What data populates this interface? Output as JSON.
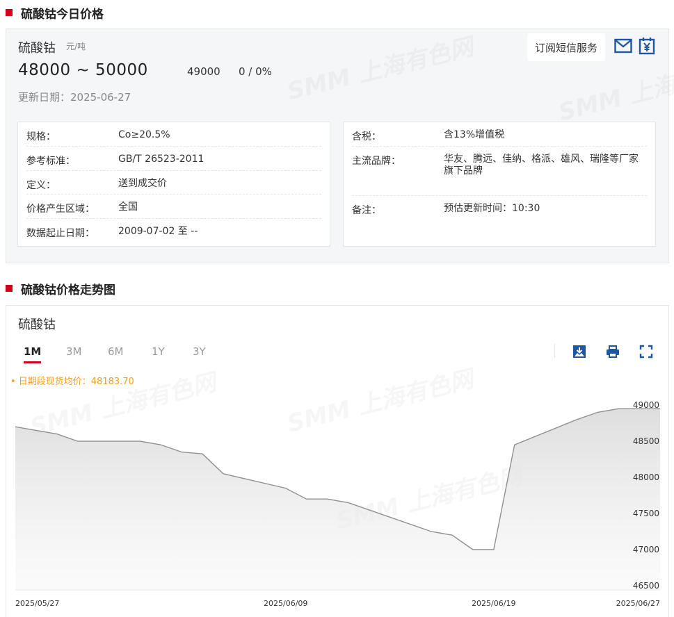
{
  "section1": {
    "title": "硫酸钴今日价格"
  },
  "product": {
    "name": "硫酸钴",
    "unit": "元/吨",
    "price_range": "48000 ~ 50000",
    "avg_price": "49000",
    "change": "0 / 0%",
    "update_date": "更新日期：2025-06-27"
  },
  "sms": {
    "label": "订阅短信服务"
  },
  "icons": {
    "mail": "mail-icon",
    "pay": "yen-icon",
    "download": "download-icon",
    "print": "printer-icon",
    "fullscreen": "fullscreen-icon"
  },
  "info_left": [
    {
      "k": "规格：",
      "v": "Co≥20.5%"
    },
    {
      "k": "参考标准：",
      "v": "GB/T 26523-2011"
    },
    {
      "k": "定义：",
      "v": "送到成交价"
    },
    {
      "k": "价格产生区域：",
      "v": "全国"
    },
    {
      "k": "数据起止日期：",
      "v": "2009-07-02 至 --"
    }
  ],
  "info_right": [
    {
      "k": "含税：",
      "v": "含13%增值税"
    },
    {
      "k": "主流品牌：",
      "v": "华友、腾远、佳纳、格派、雄风、瑞隆等厂家旗下品牌"
    },
    {
      "k": "备注：",
      "v": "预估更新时间：10:30"
    }
  ],
  "section2": {
    "title": "硫酸钴价格走势图"
  },
  "chart_panel": {
    "title": "硫酸钴",
    "tabs": [
      "1M",
      "3M",
      "6M",
      "1Y",
      "3Y"
    ],
    "active_tab": "1M",
    "avg_label": "• 日期段现货均价：48183.70"
  },
  "watermark": {
    "text": "SMM 上海有色网"
  },
  "colors": {
    "accent": "#d0021b",
    "line": "#909090",
    "avg": "#f0a020"
  },
  "chart_data": {
    "type": "area",
    "title": "",
    "xlabel": "",
    "ylabel": "",
    "ylim": [
      46500,
      49000
    ],
    "yticks": [
      46500,
      47000,
      47500,
      48000,
      48500,
      49000
    ],
    "xlim": [
      "2025-05-27",
      "2025-06-27"
    ],
    "xticks": [
      "2025/05/27",
      "2025/06/09",
      "2025/06/19",
      "2025/06/27"
    ],
    "grid": false,
    "series": [
      {
        "x": [
          "2025-05-27",
          "2025-05-28",
          "2025-05-29",
          "2025-05-30",
          "2025-06-02",
          "2025-06-03",
          "2025-06-04",
          "2025-06-05",
          "2025-06-06",
          "2025-06-09",
          "2025-06-10",
          "2025-06-11",
          "2025-06-12",
          "2025-06-13",
          "2025-06-16",
          "2025-06-17",
          "2025-06-18",
          "2025-06-19",
          "2025-06-20",
          "2025-06-23",
          "2025-06-24",
          "2025-06-25",
          "2025-06-26",
          "2025-06-27"
        ],
        "y": [
          48700,
          48650,
          48600,
          48500,
          48500,
          48450,
          48350,
          48325,
          48050,
          47850,
          47700,
          47700,
          47650,
          47550,
          47250,
          47200,
          47000,
          47000,
          48450,
          48800,
          48900,
          48950,
          48950,
          48950
        ]
      }
    ]
  }
}
